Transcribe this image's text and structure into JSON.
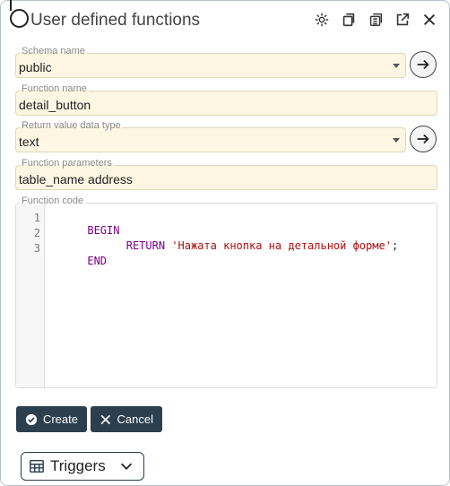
{
  "window": {
    "title": "User defined functions"
  },
  "header_icons": [
    "gear-icon",
    "copy-icon",
    "list-copy-icon",
    "external-link-icon",
    "close-icon"
  ],
  "form": {
    "schema": {
      "label": "Schema name",
      "value": "public"
    },
    "function_name": {
      "label": "Function name",
      "value": "detail_button"
    },
    "return_type": {
      "label": "Return value data type",
      "value": "text"
    },
    "parameters": {
      "label": "Function parameters",
      "value": "table_name address"
    },
    "code": {
      "label": "Function code",
      "line_numbers": [
        "1",
        "2",
        "3"
      ],
      "line1": "BEGIN",
      "line2_kw": "RETURN",
      "line2_str": "'Нажата кнопка на детальной форме'",
      "line2_end": ";",
      "line3": "END"
    }
  },
  "actions": {
    "create_label": "Create",
    "cancel_label": "Cancel"
  },
  "triggers": {
    "label": "Triggers"
  },
  "colors": {
    "field_bg": "#fdf6e3",
    "button_bg": "#2b3f4f",
    "keyword": "#770088",
    "string": "#aa1111"
  }
}
